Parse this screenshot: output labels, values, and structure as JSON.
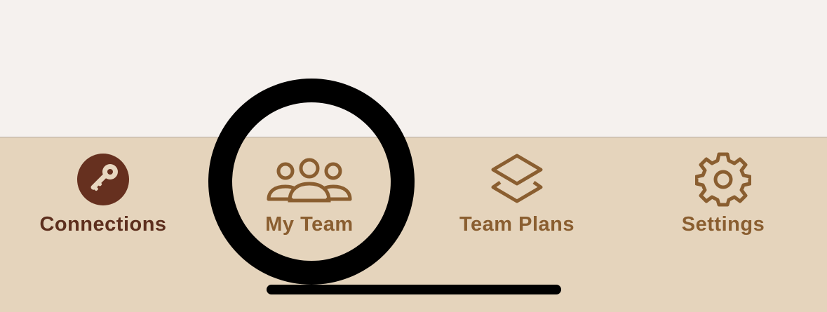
{
  "tabs": [
    {
      "id": "connections",
      "label": "Connections",
      "icon": "key-icon",
      "active": true
    },
    {
      "id": "my-team",
      "label": "My Team",
      "icon": "people-group-icon",
      "active": false
    },
    {
      "id": "team-plans",
      "label": "Team Plans",
      "icon": "layers-icon",
      "active": false
    },
    {
      "id": "settings",
      "label": "Settings",
      "icon": "gear-icon",
      "active": false
    }
  ],
  "colors": {
    "tab_bar_bg": "#e5d4bc",
    "page_bg": "#f5f1ee",
    "active_color": "#5d2f1e",
    "inactive_color": "#8a5e30"
  }
}
